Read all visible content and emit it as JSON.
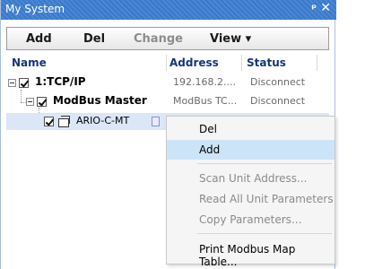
{
  "window": {
    "title": "My System",
    "pin_icon": "pin-icon",
    "close_icon": "close-icon"
  },
  "toolbar": {
    "add": "Add",
    "del": "Del",
    "change": "Change",
    "view": "View ▾"
  },
  "columns": {
    "name": "Name",
    "address": "Address",
    "status": "Status"
  },
  "tree": [
    {
      "name": "1:TCP/IP",
      "address": "192.168.2....",
      "status": "Disconnect"
    },
    {
      "name": "ModBus Master",
      "address": "ModBus TC...",
      "status": "Disconnect"
    },
    {
      "name": "ARIO-C-MT",
      "address": "",
      "status": ""
    }
  ],
  "context_menu": {
    "items": [
      {
        "label": "Del",
        "enabled": true
      },
      {
        "label": "Add",
        "enabled": true,
        "highlighted": true
      },
      {
        "label": "Scan Unit Address...",
        "enabled": false
      },
      {
        "label": "Read All Unit Parameters",
        "enabled": false
      },
      {
        "label": "Copy Parameters...",
        "enabled": false
      },
      {
        "label": "Print Modbus Map Table...",
        "enabled": true
      }
    ]
  },
  "colors": {
    "title_bar": "#3b78c8",
    "highlight": "#cce4f7",
    "selected_row": "#dbe7f7",
    "header_text": "#17347a"
  }
}
